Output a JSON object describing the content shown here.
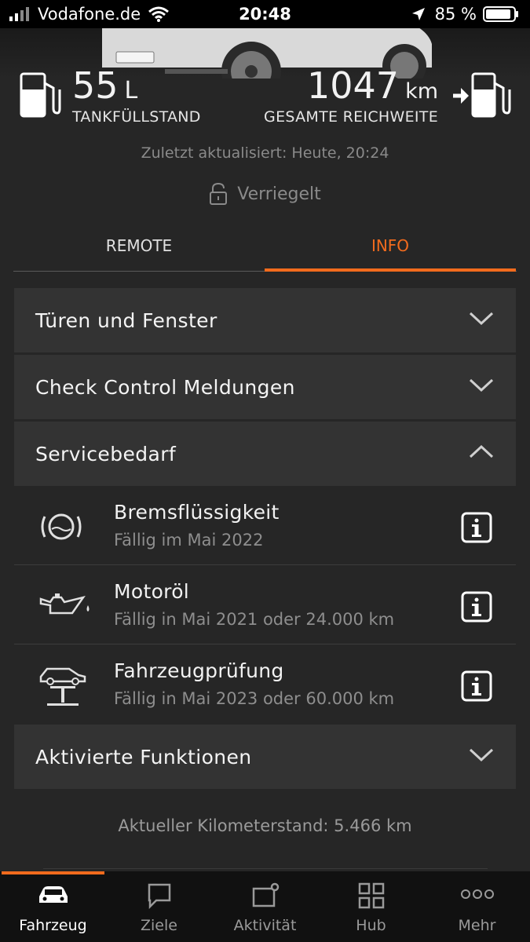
{
  "status_bar": {
    "carrier": "Vodafone.de",
    "time": "20:48",
    "battery": "85 %"
  },
  "vehicle": {
    "fuel_value": "55",
    "fuel_unit": "L",
    "fuel_label": "TANKFÜLLSTAND",
    "range_value": "1047",
    "range_unit": "km",
    "range_label": "GESAMTE REICHWEITE",
    "updated": "Zuletzt aktualisiert: Heute, 20:24",
    "lock_status": "Verriegelt"
  },
  "tabs": [
    {
      "label": "REMOTE",
      "active": false
    },
    {
      "label": "INFO",
      "active": true
    }
  ],
  "sections": {
    "doors": "Türen und Fenster",
    "check_control": "Check Control Meldungen",
    "service": "Servicebedarf",
    "functions": "Aktivierte Funktionen"
  },
  "service_items": [
    {
      "title": "Bremsflüssigkeit",
      "subtitle": "Fällig im Mai 2022",
      "icon": "brake-fluid-icon"
    },
    {
      "title": "Motoröl",
      "subtitle": "Fällig in Mai 2021 oder 24.000 km",
      "icon": "engine-oil-icon"
    },
    {
      "title": "Fahrzeugprüfung",
      "subtitle": "Fällig in Mai 2023 oder 60.000 km",
      "icon": "vehicle-lift-icon"
    }
  ],
  "mileage": "Aktueller Kilometerstand: 5.466 km",
  "bottom_nav": [
    {
      "label": "Fahrzeug",
      "icon": "car-icon",
      "active": true
    },
    {
      "label": "Ziele",
      "icon": "chat-bubble-icon",
      "active": false
    },
    {
      "label": "Aktivität",
      "icon": "activity-icon",
      "active": false
    },
    {
      "label": "Hub",
      "icon": "grid-icon",
      "active": false
    },
    {
      "label": "Mehr",
      "icon": "more-dots-icon",
      "active": false
    }
  ],
  "colors": {
    "accent": "#f26b1d",
    "background": "#262626",
    "card": "#333333"
  }
}
